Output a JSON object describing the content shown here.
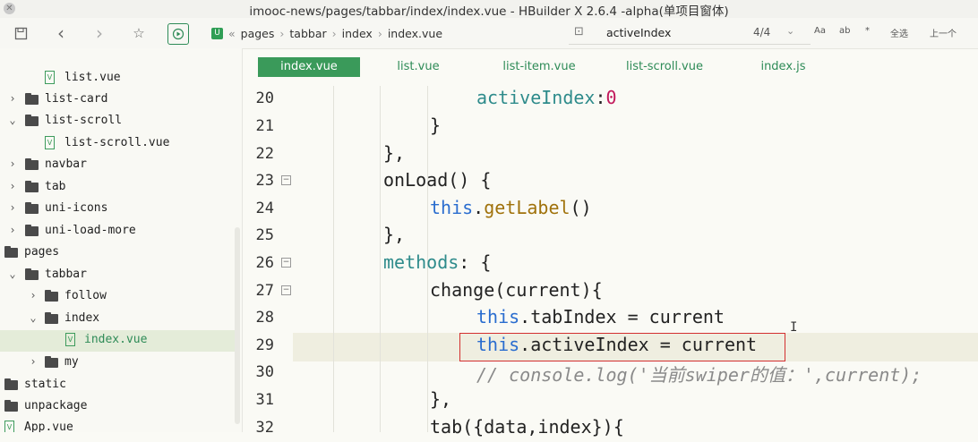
{
  "window": {
    "title": "imooc-news/pages/tabbar/index/index.vue - HBuilder X 2.6.4 -alpha(单项目窗体)"
  },
  "toolbar": {
    "breadcrumb": [
      "pages",
      "tabbar",
      "index",
      "index.vue"
    ],
    "breadcrumb_prefix": "«",
    "search": {
      "query": "activeIndex",
      "count": "4/4"
    },
    "search_options": [
      "Aa",
      "ab",
      "*",
      "全选",
      "上一个"
    ]
  },
  "sidebar": {
    "items": [
      {
        "label": "list.vue",
        "type": "file"
      },
      {
        "label": "list-card",
        "type": "folder",
        "chev": "›"
      },
      {
        "label": "list-scroll",
        "type": "folder",
        "chev": "⌄"
      },
      {
        "label": "list-scroll.vue",
        "type": "file"
      },
      {
        "label": "navbar",
        "type": "folder",
        "chev": "›"
      },
      {
        "label": "tab",
        "type": "folder",
        "chev": "›"
      },
      {
        "label": "uni-icons",
        "type": "folder",
        "chev": "›"
      },
      {
        "label": "uni-load-more",
        "type": "folder",
        "chev": "›"
      },
      {
        "label": "pages",
        "type": "folder"
      },
      {
        "label": "tabbar",
        "type": "folder",
        "chev": "⌄"
      },
      {
        "label": "follow",
        "type": "folder",
        "chev": "›"
      },
      {
        "label": "index",
        "type": "folder",
        "chev": "⌄"
      },
      {
        "label": "index.vue",
        "type": "file",
        "selected": true
      },
      {
        "label": "my",
        "type": "folder",
        "chev": "›"
      },
      {
        "label": "static",
        "type": "folder"
      },
      {
        "label": "unpackage",
        "type": "folder"
      },
      {
        "label": "App.vue",
        "type": "file"
      }
    ]
  },
  "tabs": [
    "index.vue",
    "list.vue",
    "list-item.vue",
    "list-scroll.vue",
    "index.js"
  ],
  "editor": {
    "lines": [
      {
        "num": "20"
      },
      {
        "num": "21"
      },
      {
        "num": "22"
      },
      {
        "num": "23"
      },
      {
        "num": "24"
      },
      {
        "num": "25"
      },
      {
        "num": "26"
      },
      {
        "num": "27"
      },
      {
        "num": "28"
      },
      {
        "num": "29"
      },
      {
        "num": "30"
      },
      {
        "num": "31"
      },
      {
        "num": "32"
      }
    ],
    "tokens": {
      "l20_a": "activeIndex",
      "l20_b": ":",
      "l20_c": "0",
      "l21": "}",
      "l22": "},",
      "l23": "onLoad() {",
      "l24_a": "this",
      "l24_b": ".",
      "l24_c": "getLabel",
      "l24_d": "()",
      "l25": "},",
      "l26_a": "methods",
      "l26_b": ": {",
      "l27": "change(current){",
      "l28_a": "this",
      "l28_b": ".tabIndex = current",
      "l29_a": "this",
      "l29_b": ".activeIndex = current",
      "l30": "// console.log('当前swiper的值：',current);",
      "l31": "},",
      "l32": "tab({data,index}){"
    }
  }
}
